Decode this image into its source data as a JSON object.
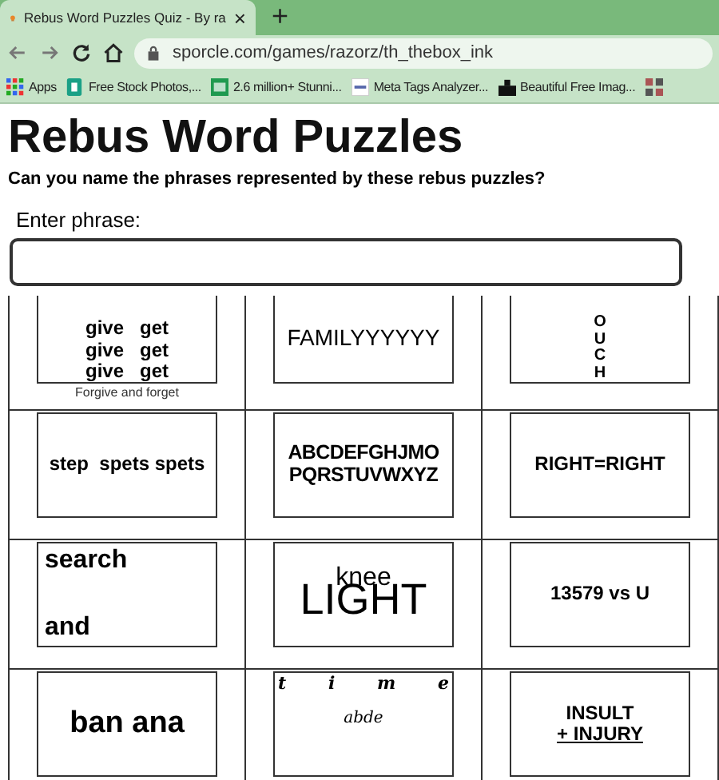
{
  "browser": {
    "tab": {
      "title": "Rebus Word Puzzles Quiz - By ra",
      "close": "×"
    },
    "new_tab": "+",
    "address": "sporcle.com/games/razorz/th_thebox_ink",
    "bookmarks": [
      {
        "label": "Apps",
        "kind": "apps"
      },
      {
        "label": "Free Stock Photos,...",
        "kind": "doc"
      },
      {
        "label": "2.6 million+ Stunni...",
        "kind": "px"
      },
      {
        "label": "Meta Tags Analyzer...",
        "kind": "sst"
      },
      {
        "label": "Beautiful Free Imag...",
        "kind": "cam"
      }
    ]
  },
  "page": {
    "title": "Rebus Word Puzzles",
    "subtitle": "Can you name the phrases represented by these rebus puzzles?",
    "field_label": "Enter phrase:"
  },
  "puzzles": [
    {
      "kind": "stack",
      "lines": [
        {
          "text": "give   get"
        },
        {
          "text": "give   get"
        },
        {
          "text": "give   get"
        }
      ],
      "caption": "Forgive and forget"
    },
    {
      "kind": "plain",
      "lines": [
        {
          "text": "FAMILYYYYYY"
        }
      ]
    },
    {
      "kind": "vertical",
      "lines": [
        {
          "text": "O"
        },
        {
          "text": "U"
        },
        {
          "text": "C"
        },
        {
          "text": "H"
        }
      ]
    },
    {
      "kind": "mono",
      "lines": [
        {
          "text": "step  spets spets"
        }
      ]
    },
    {
      "kind": "heavy",
      "lines": [
        {
          "text": "ABCDEFGHJMO"
        },
        {
          "text": "PQRSTUVWXYZ"
        }
      ]
    },
    {
      "kind": "mono",
      "lines": [
        {
          "text": "RIGHT=RIGHT"
        }
      ]
    },
    {
      "kind": "split",
      "lines": [
        {
          "text": "search"
        },
        {
          "text": "and"
        }
      ]
    },
    {
      "kind": "overlap",
      "lines": [
        {
          "text": "knee"
        },
        {
          "text": "LIGHT"
        }
      ]
    },
    {
      "kind": "mono",
      "lines": [
        {
          "text": "13579 vs U"
        }
      ]
    },
    {
      "kind": "large",
      "lines": [
        {
          "text": "ban ana"
        }
      ]
    },
    {
      "kind": "spread",
      "lines": [
        {
          "text": "t"
        },
        {
          "text": "i"
        },
        {
          "text": "m"
        },
        {
          "text": "e"
        },
        {
          "text": "abde"
        }
      ]
    },
    {
      "kind": "mono",
      "lines": [
        {
          "text": "INSULT",
          "underline": false
        },
        {
          "text": "+ INJURY",
          "underline": true
        }
      ]
    }
  ]
}
